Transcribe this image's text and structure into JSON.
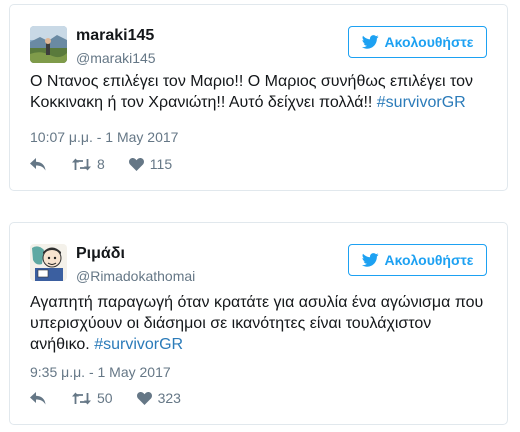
{
  "tweets": [
    {
      "display_name": "maraki145",
      "handle": "@maraki145",
      "follow_label": "Ακολουθήστε",
      "text_before": "Ο Ντανος επιλέγει τον Μαριο!! Ο Μαριος συνήθως επιλέγει τον Κοκκινακη ή τον Χρανιώτη!! Αυτό δείχνει πολλά!! ",
      "hashtag": "#survivorGR",
      "timestamp": "10:07 μ.μ. - 1 May 2017",
      "retweets": "8",
      "likes": "115",
      "avatar_icon": "landscape-avatar-icon"
    },
    {
      "display_name": "Ριμάδι",
      "handle": "@Rimadokathomai",
      "follow_label": "Ακολουθήστε",
      "text_before": "Αγαπητή παραγωγή όταν κρατάτε για ασυλία ένα αγώνισμα που υπερισχύουν οι διάσημοι σε ικανότητες είναι τουλάχιστον ανήθικο. ",
      "hashtag": "#survivorGR",
      "timestamp": "9:35 μ.μ. - 1 May 2017",
      "retweets": "50",
      "likes": "323",
      "avatar_icon": "cartoon-avatar-icon"
    }
  ],
  "colors": {
    "accent": "#1da1f2",
    "link": "#2b7bb9",
    "muted": "#657786",
    "border": "#e1e8ed"
  },
  "icons": [
    "twitter-bird-icon",
    "reply-icon",
    "retweet-icon",
    "heart-icon"
  ]
}
